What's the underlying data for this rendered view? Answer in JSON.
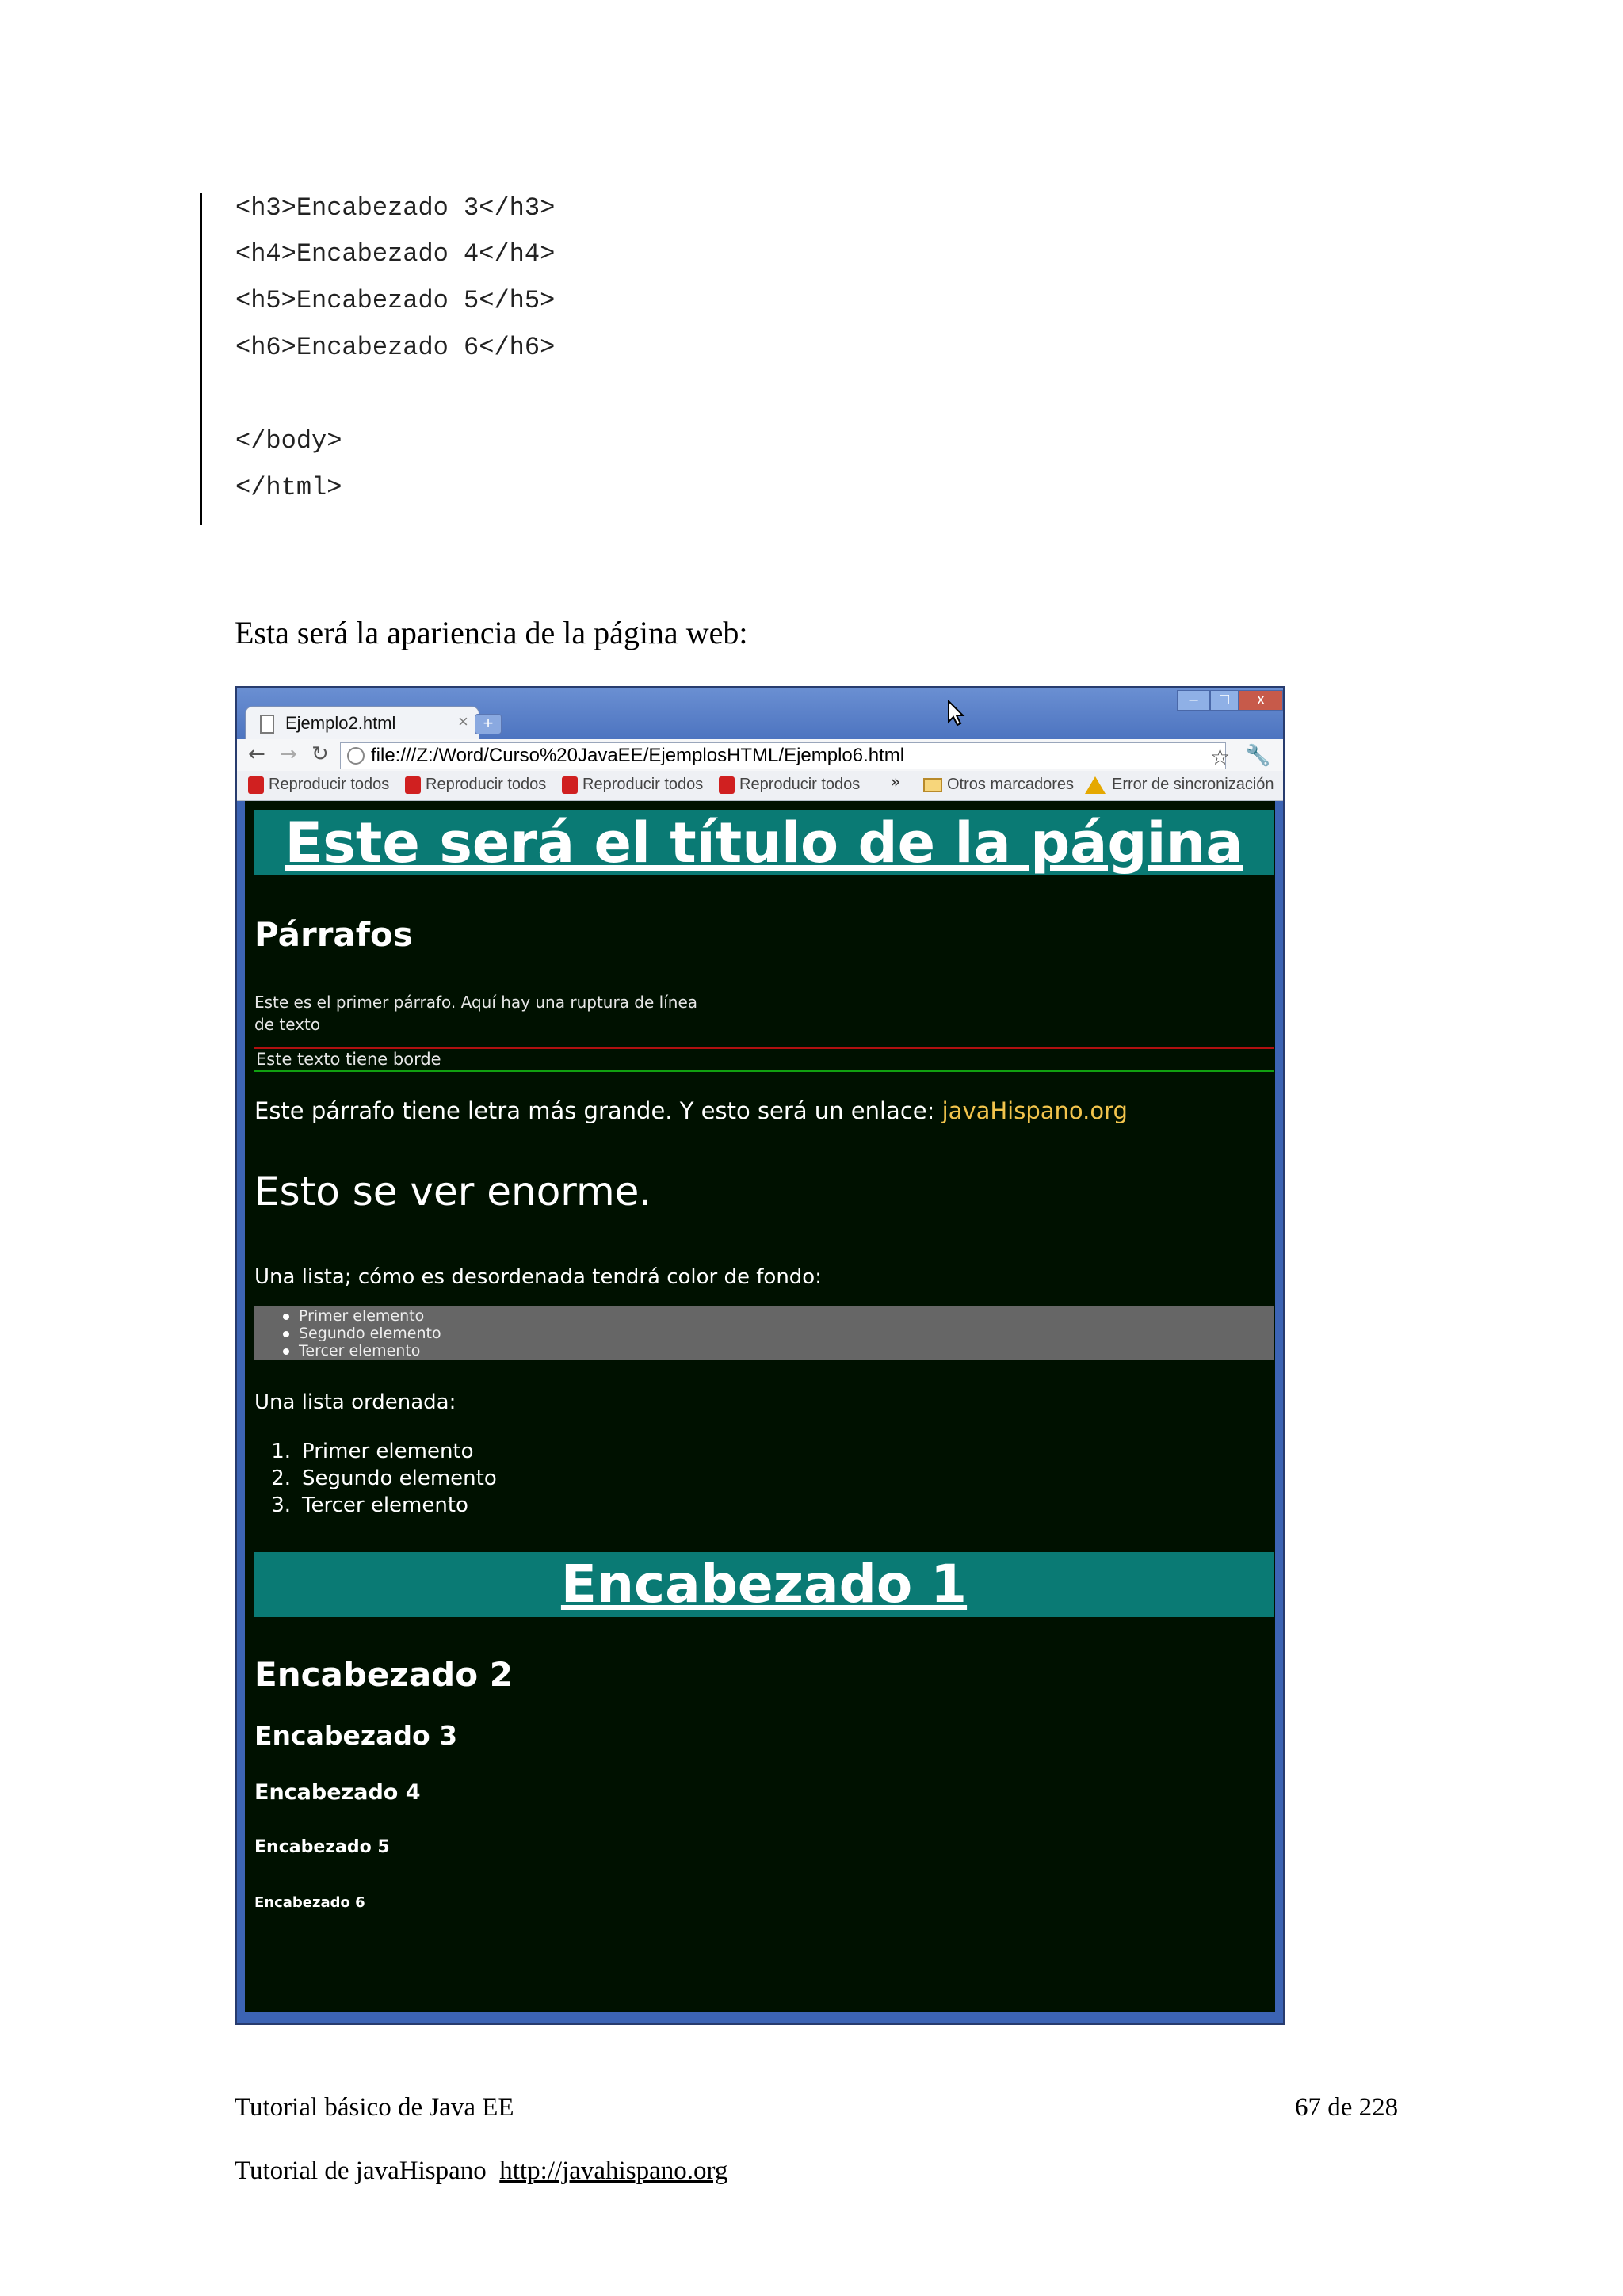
{
  "code": {
    "lines": [
      "<h3>Encabezado 3</h3>",
      "<h4>Encabezado 4</h4>",
      "<h5>Encabezado 5</h5>",
      "<h6>Encabezado 6</h6>",
      "</body>",
      "</html>"
    ]
  },
  "intro": "Esta será la apariencia de la página web:",
  "browser": {
    "tab_title": "Ejemplo2.html",
    "tab_close": "×",
    "new_tab": "+",
    "window_buttons": [
      "–",
      "□",
      "x"
    ],
    "url": "file:///Z:/Word/Curso%20JavaEE/EjemplosHTML/Ejemplo6.html",
    "bookmarks": [
      "Reproducir todos",
      "Reproducir todos",
      "Reproducir todos",
      "Reproducir todos"
    ],
    "bookmarks_more": "»",
    "other_bookmarks": "Otros marcadores",
    "sync_error": "Error de sincronización",
    "icons": [
      "back-arrow-icon",
      "forward-arrow-icon",
      "reload-icon",
      "star-icon",
      "wrench-icon",
      "youtube-icon",
      "folder-icon",
      "warning-icon",
      "mouse-cursor-icon"
    ]
  },
  "webpage": {
    "title": "Este será el título de la página",
    "h2_parrafos": "Párrafos",
    "para1_line1": "Este es el primer párrafo. Aquí hay una ruptura de línea",
    "para1_line2": "de texto",
    "bordered": "Este texto tiene borde",
    "big_text": "Este párrafo tiene letra más grande. Y esto será un enlace: ",
    "link": "javaHispano.org",
    "huge": "Esto se ver enorme.",
    "ul_intro": "Una lista; cómo es desordenada tendrá color de fondo:",
    "ul_items": [
      "Primer elemento",
      "Segundo elemento",
      "Tercer elemento"
    ],
    "ol_intro": "Una lista ordenada:",
    "ol_items": [
      "Primer elemento",
      "Segundo elemento",
      "Tercer elemento"
    ],
    "ol_numbers": [
      "1.",
      "2.",
      "3."
    ],
    "h1": "Encabezado 1",
    "h2": "Encabezado 2",
    "h3": "Encabezado 3",
    "h4": "Encabezado 4",
    "h5": "Encabezado 5",
    "h6": "Encabezado 6",
    "colors": {
      "background": "#001100",
      "heading_band": "#0a7a74",
      "link": "#f2c44c",
      "list_bg": "#666666"
    }
  },
  "footer": {
    "doc_title": "Tutorial básico de Java EE",
    "page": "67 de 228",
    "tutorial_label": "Tutorial de javaHispano",
    "url": "http://javahispano.org"
  }
}
